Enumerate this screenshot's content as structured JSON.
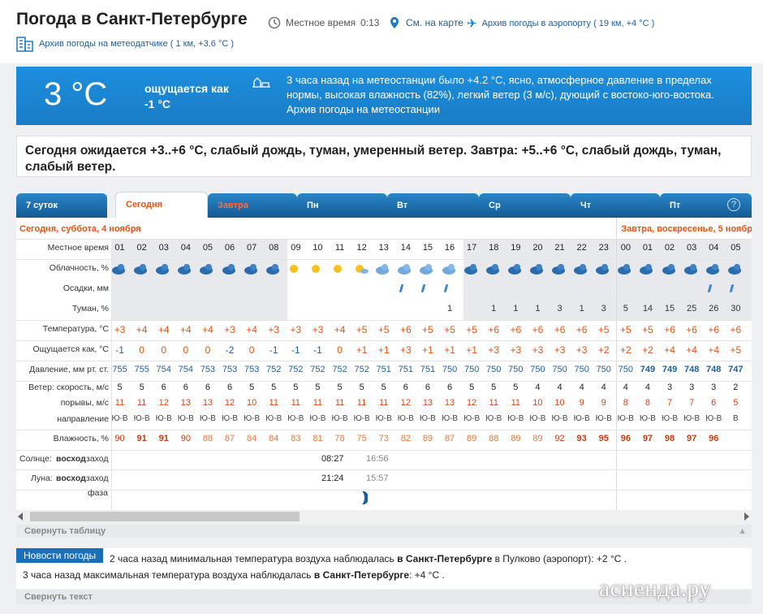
{
  "header": {
    "title": "Погода в Санкт-Петербурге",
    "local_time_label": "Местное время",
    "local_time": "0:13",
    "map_link": "См. на карте",
    "airport_link": "Архив погоды в аэропорту ( 19 км, +4 °C )",
    "station_link": "Архив погоды на метеодатчике ( 1 км, +3.6 °C )"
  },
  "current": {
    "temp": "3 °C",
    "feels": "ощущается как -1 °C",
    "text": "3 часа назад на метеостанции было +4.2 °C, ясно, атмосферное давление в пределах нормы, высокая влажность (82%), легкий ветер (3 м/с), дующий с востоко-юго-востока.",
    "archive": "Архив погоды на метеостанции"
  },
  "forecast": "Сегодня ожидается +3..+6 °C, слабый дождь, туман, умеренный ветер. Завтра: +5..+6 °C, слабый дождь, туман, слабый ветер.",
  "tabs": [
    "7 суток",
    "Сегодня",
    "Завтра",
    "Пн",
    "Вт",
    "Ср",
    "Чт",
    "Пт"
  ],
  "help": "?",
  "day_today": "Сегодня, суббота, 4 ноября",
  "day_tomorrow": "Завтра, воскресенье, 5 ноябр",
  "labels": {
    "time": "Местное время",
    "clouds": "Облачность, %",
    "precip": "Осадки, мм",
    "fog": "Туман, %",
    "temp": "Температура, °C",
    "feels": "Ощущается как, °C",
    "pressure": "Давление, мм рт. ст.",
    "wind": "Ветер: скорость, м/с",
    "gusts": "порывы, м/с",
    "dir": "направление",
    "hum": "Влажность, %",
    "sun_pre": "Солнце:",
    "sun_rise": "восход",
    "sun_set": "заход",
    "moon_pre": "Луна:",
    "moon_rise": "восход",
    "moon_set": "заход",
    "phase": "фаза"
  },
  "hours": [
    "01",
    "02",
    "03",
    "04",
    "05",
    "06",
    "07",
    "08",
    "09",
    "10",
    "11",
    "12",
    "13",
    "14",
    "15",
    "16",
    "17",
    "18",
    "19",
    "20",
    "21",
    "22",
    "23",
    "00",
    "01",
    "02",
    "03",
    "04",
    "05"
  ],
  "fog": [
    "",
    "",
    "",
    "",
    "",
    "",
    "",
    "",
    "",
    "",
    "",
    "",
    "",
    "",
    "",
    "1",
    "",
    "1",
    "1",
    "1",
    "3",
    "1",
    "3",
    "5",
    "14",
    "15",
    "25",
    "26",
    "30"
  ],
  "temps": [
    "+3",
    "+4",
    "+4",
    "+4",
    "+4",
    "+3",
    "+4",
    "+3",
    "+3",
    "+3",
    "+4",
    "+5",
    "+5",
    "+6",
    "+5",
    "+5",
    "+5",
    "+6",
    "+6",
    "+6",
    "+6",
    "+6",
    "+5",
    "+5",
    "+5",
    "+6",
    "+6",
    "+6",
    "+6"
  ],
  "feels_row": [
    "-1",
    "0",
    "0",
    "0",
    "0",
    "-2",
    "0",
    "-1",
    "-1",
    "-1",
    "0",
    "+1",
    "+1",
    "+3",
    "+1",
    "+1",
    "+1",
    "+3",
    "+3",
    "+3",
    "+3",
    "+3",
    "+2",
    "+2",
    "+2",
    "+4",
    "+4",
    "+4",
    "+5"
  ],
  "pressure": [
    "755",
    "755",
    "754",
    "754",
    "753",
    "753",
    "753",
    "752",
    "752",
    "752",
    "752",
    "752",
    "751",
    "751",
    "751",
    "750",
    "750",
    "750",
    "750",
    "750",
    "750",
    "750",
    "750",
    "750",
    "749",
    "749",
    "748",
    "748",
    "747"
  ],
  "wind": [
    "5",
    "5",
    "6",
    "6",
    "6",
    "6",
    "5",
    "5",
    "5",
    "5",
    "5",
    "5",
    "5",
    "6",
    "6",
    "6",
    "5",
    "5",
    "5",
    "4",
    "4",
    "4",
    "4",
    "4",
    "4",
    "3",
    "3",
    "3",
    "2"
  ],
  "gusts": [
    "11",
    "11",
    "12",
    "13",
    "13",
    "12",
    "10",
    "11",
    "11",
    "11",
    "11",
    "11",
    "11",
    "12",
    "13",
    "13",
    "12",
    "11",
    "11",
    "10",
    "10",
    "9",
    "9",
    "8",
    "8",
    "7",
    "7",
    "6",
    "5"
  ],
  "dirs": [
    "Ю-В",
    "Ю-В",
    "Ю-В",
    "Ю-В",
    "Ю-В",
    "Ю-В",
    "Ю-В",
    "Ю-В",
    "Ю-В",
    "Ю-В",
    "Ю-В",
    "Ю-В",
    "Ю-В",
    "Ю-В",
    "Ю-В",
    "Ю-В",
    "Ю-В",
    "Ю-В",
    "Ю-В",
    "Ю-В",
    "Ю-В",
    "Ю-В",
    "Ю-В",
    "Ю-В",
    "Ю-В",
    "Ю-В",
    "Ю-В",
    "Ю-В",
    "В"
  ],
  "hum": [
    "90",
    "91",
    "91",
    "90",
    "88",
    "87",
    "84",
    "84",
    "83",
    "81",
    "78",
    "75",
    "73",
    "82",
    "89",
    "87",
    "89",
    "88",
    "89",
    "89",
    "92",
    "93",
    "95",
    "96",
    "97",
    "98",
    "97",
    "96"
  ],
  "sun": {
    "rise": "08:27",
    "set": "16:56"
  },
  "moon": {
    "rise": "21:24",
    "set": "15:57"
  },
  "collapse_table": "Свернуть таблицу",
  "news": {
    "tag": "Новости погоды",
    "line1_a": "2 часа назад минимальная температура воздуха наблюдалась ",
    "line1_b": "в Санкт-Петербурге",
    "line1_c": " в Пулково (аэропорт): +2 °C .",
    "line2_a": "3 часа назад максимальная температура воздуха наблюдалась ",
    "line2_b": "в Санкт-Петербурге",
    "line2_c": ": +4 °C ."
  },
  "collapse_text": "Свернуть текст",
  "watermark": "асиенда.ру",
  "colors": {
    "accent": "#1a7cc6",
    "warm": "#e65314",
    "cool": "#1f5f9f"
  }
}
